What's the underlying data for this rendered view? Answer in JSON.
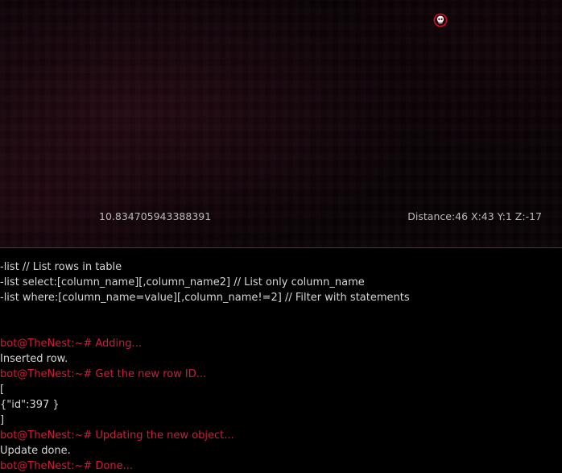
{
  "hud": {
    "value": "10.834705943388391",
    "coords": "Distance:46 X:43 Y:1 Z:-17"
  },
  "colors": {
    "prompt": "#d11a3a",
    "output": "#d6d6d6",
    "hud": "#b9b9b9",
    "background": "#000000"
  },
  "icons": {
    "marker": "skull-marker-icon"
  },
  "console": {
    "lines": [
      {
        "type": "output",
        "text": "-list // List rows in table"
      },
      {
        "type": "output",
        "text": "-list select:[column_name][,column_name2] // List only column_name"
      },
      {
        "type": "output",
        "text": "-list where:[column_name=value][,column_name!=2] // Filter with statements"
      },
      {
        "type": "blank",
        "text": ""
      },
      {
        "type": "blank",
        "text": ""
      },
      {
        "type": "prompt",
        "text": "bot@TheNest:~# Adding..."
      },
      {
        "type": "output",
        "text": "Inserted row."
      },
      {
        "type": "prompt",
        "text": "bot@TheNest:~# Get the new row ID..."
      },
      {
        "type": "output",
        "text": "["
      },
      {
        "type": "output",
        "text": "{\"id\":397 }"
      },
      {
        "type": "output",
        "text": "]"
      },
      {
        "type": "prompt",
        "text": "bot@TheNest:~# Updating the new object..."
      },
      {
        "type": "output",
        "text": "Update done."
      },
      {
        "type": "prompt",
        "text": "bot@TheNest:~# Done..."
      }
    ]
  }
}
